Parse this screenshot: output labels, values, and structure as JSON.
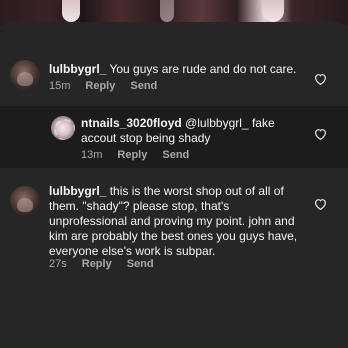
{
  "comments": [
    {
      "username": "lulbbygrl_",
      "text": "You guys are rude and do not care.",
      "time": "15m",
      "reply_label": "Reply",
      "send_label": "Send"
    },
    {
      "username": "ntnails_3020floyd",
      "mention": "@lulbbygrl_",
      "text": "fake accout stop being shady",
      "time": "13m",
      "reply_label": "Reply",
      "send_label": "Send"
    },
    {
      "username": "lulbbygrl_",
      "text": "this is the worst shop out of all of them. \"shady\"? please stop, that's unprofessional and proving my point. john and kim are probably the best ones you guys have, everyone else's work is subpar.",
      "time": "27s",
      "reply_label": "Reply",
      "send_label": "Send"
    }
  ],
  "icons": {
    "like": "heart-outline-icon"
  },
  "colors": {
    "background": "#262626",
    "reply_background": "#1c1c1c",
    "text": "#f5f5f5",
    "meta": "#a8a8a8"
  }
}
